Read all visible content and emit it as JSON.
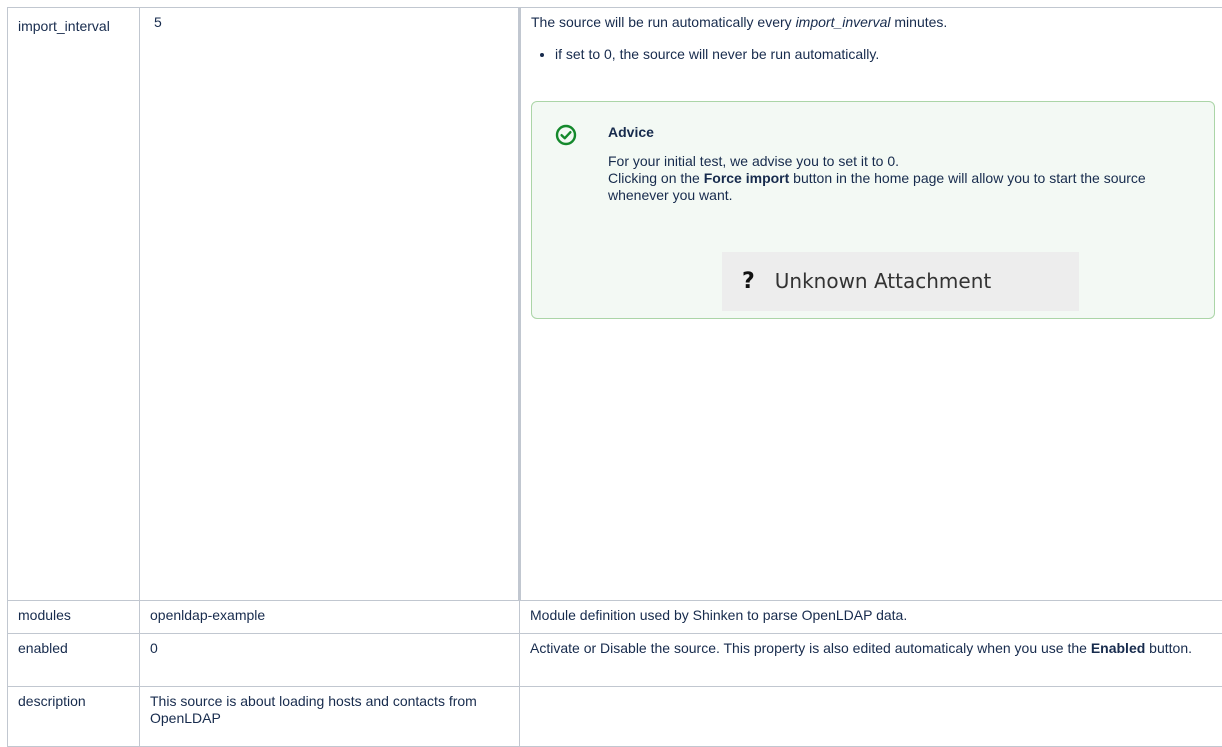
{
  "rows": [
    {
      "name": "import_interval",
      "value": "5",
      "description": {
        "text_before": "The source will be run automatically every ",
        "text_em": "import_inverval",
        "text_after": " minutes.",
        "bullets": [
          "if set to 0, the source will never be run automatically."
        ],
        "advice": {
          "title": "Advice",
          "line1": "For your initial test, we advise you to set it to 0.",
          "line2_before": "Clicking on the ",
          "line2_bold": "Force import",
          "line2_after": " button in the home page will allow you to start the source whenever you want.",
          "icon": "check-circle-icon",
          "color": "#14892c"
        },
        "attachment": {
          "glyph": "?",
          "label": "Unknown Attachment"
        }
      }
    },
    {
      "name": "modules",
      "value": "openldap-example",
      "description": "Module definition used by Shinken to parse OpenLDAP data."
    },
    {
      "name": "enabled",
      "value": "0",
      "description_before": "Activate or Disable the source. This property is also edited automaticaly when you use the ",
      "description_bold": "Enabled",
      "description_after": " button."
    },
    {
      "name": "description",
      "value": "This source is about loading hosts and contacts from OpenLDAP",
      "description": ""
    }
  ]
}
